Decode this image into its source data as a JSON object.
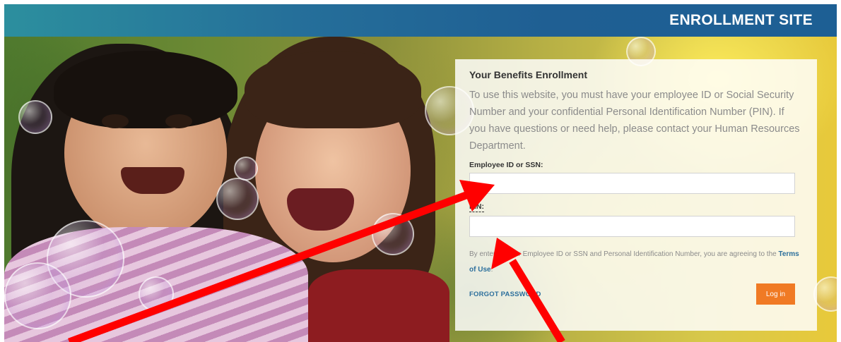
{
  "header": {
    "title": "ENROLLMENT SITE"
  },
  "login_panel": {
    "title": "Your Benefits Enrollment",
    "description": "To use this website, you must have your employee ID or Social Security Number and your confidential Personal Identification Number (PIN). If you have questions or need help, please contact your Human Resources Department.",
    "employee_id_label": "Employee ID or SSN:",
    "employee_id_value": "",
    "pin_label": "PIN:",
    "pin_value": "",
    "terms_text": "By entering your Employee ID or SSN and Personal Identification Number, you are agreeing to the ",
    "terms_link": "Terms of Use",
    "terms_end": ".",
    "forgot_password": "FORGOT PASSWORD",
    "login_button": "Log in"
  },
  "colors": {
    "header_bg": "#1f5f93",
    "link": "#2c6f9c",
    "button": "#f07a24",
    "arrow": "#ff0000"
  }
}
